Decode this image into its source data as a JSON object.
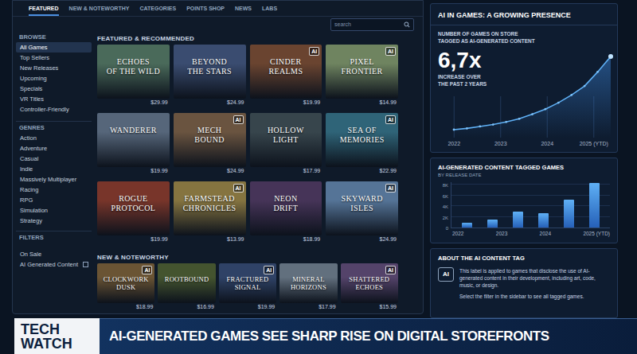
{
  "nav": {
    "tabs": [
      {
        "label": "FEATURED",
        "selected": true
      },
      {
        "label": "NEW & NOTEWORTHY",
        "selected": false
      },
      {
        "label": "CATEGORIES",
        "selected": false
      },
      {
        "label": "POINTS SHOP",
        "selected": false
      },
      {
        "label": "NEWS",
        "selected": false
      },
      {
        "label": "LABS",
        "selected": false
      }
    ]
  },
  "search": {
    "placeholder": "search"
  },
  "sidebar": {
    "sections": [
      {
        "heading": "BROWSE",
        "items": [
          {
            "label": "All Games",
            "selected": true
          },
          {
            "label": "Top Sellers",
            "selected": false
          },
          {
            "label": "New Releases",
            "selected": false
          },
          {
            "label": "Upcoming",
            "selected": false
          },
          {
            "label": "Specials",
            "selected": false
          },
          {
            "label": "VR Titles",
            "selected": false
          },
          {
            "label": "Controller-Friendly",
            "selected": false
          }
        ]
      },
      {
        "heading": "GENRES",
        "items": [
          {
            "label": "Action",
            "selected": false
          },
          {
            "label": "Adventure",
            "selected": false
          },
          {
            "label": "Casual",
            "selected": false
          },
          {
            "label": "Indie",
            "selected": false
          },
          {
            "label": "Massively Multiplayer",
            "selected": false
          },
          {
            "label": "Racing",
            "selected": false
          },
          {
            "label": "RPG",
            "selected": false
          },
          {
            "label": "Simulation",
            "selected": false
          },
          {
            "label": "Strategy",
            "selected": false
          }
        ]
      }
    ],
    "filters": {
      "heading": "FILTERS",
      "items": [
        {
          "label": "On Sale",
          "kind": "link"
        },
        {
          "label": "AI Generated Content",
          "kind": "checkbox",
          "checked": false
        }
      ]
    }
  },
  "ai_badge": "AI",
  "featured": {
    "heading": "FEATURED & RECOMMENDED",
    "games": [
      {
        "title_lines": [
          "ECHOES",
          "OF THE WILD"
        ],
        "price": "$29.99",
        "ai_tagged": false,
        "color": "#4a6a5a"
      },
      {
        "title_lines": [
          "BEYOND",
          "THE STARS"
        ],
        "price": "$24.99",
        "ai_tagged": false,
        "color": "#3a4c70"
      },
      {
        "title_lines": [
          "CINDER",
          "REALMS"
        ],
        "price": "$19.99",
        "ai_tagged": true,
        "color": "#6a4430"
      },
      {
        "title_lines": [
          "PIXEL",
          "FRONTIER"
        ],
        "price": "$14.99",
        "ai_tagged": true,
        "color": "#6f8460"
      },
      {
        "title_lines": [
          "WANDERER"
        ],
        "price": "$19.99",
        "ai_tagged": false,
        "color": "#56667a"
      },
      {
        "title_lines": [
          "MECH",
          "BOUND"
        ],
        "price": "$24.99",
        "ai_tagged": true,
        "color": "#6a5440"
      },
      {
        "title_lines": [
          "HOLLOW",
          "LIGHT"
        ],
        "price": "$17.99",
        "ai_tagged": false,
        "color": "#37454c"
      },
      {
        "title_lines": [
          "SEA OF",
          "MEMORIES"
        ],
        "price": "$22.99",
        "ai_tagged": true,
        "color": "#2f6478"
      },
      {
        "title_lines": [
          "ROGUE",
          "PROTOCOL"
        ],
        "price": "$19.99",
        "ai_tagged": false,
        "color": "#78352a"
      },
      {
        "title_lines": [
          "FARMSTEAD",
          "CHRONICLES"
        ],
        "price": "$13.99",
        "ai_tagged": true,
        "color": "#857440"
      },
      {
        "title_lines": [
          "NEON",
          "DRIFT"
        ],
        "price": "$18.99",
        "ai_tagged": false,
        "color": "#463458"
      },
      {
        "title_lines": [
          "SKYWARD",
          "ISLES"
        ],
        "price": "$24.99",
        "ai_tagged": true,
        "color": "#557497"
      }
    ]
  },
  "new": {
    "heading": "NEW & NOTEWORTHY",
    "games": [
      {
        "title_lines": [
          "CLOCKWORK",
          "DUSK"
        ],
        "price": "$18.99",
        "ai_tagged": true,
        "color": "#6a5434"
      },
      {
        "title_lines": [
          "ROOTBOUND"
        ],
        "price": "$16.99",
        "ai_tagged": false,
        "color": "#44542f"
      },
      {
        "title_lines": [
          "FRACTURED",
          "SIGNAL"
        ],
        "price": "$19.99",
        "ai_tagged": true,
        "color": "#2f4266"
      },
      {
        "title_lines": [
          "MINERAL",
          "HORIZONS"
        ],
        "price": "$17.99",
        "ai_tagged": false,
        "color": "#62707e"
      },
      {
        "title_lines": [
          "SHATTERED",
          "ECHOES"
        ],
        "price": "$15.99",
        "ai_tagged": true,
        "color": "#54436a"
      }
    ]
  },
  "growth_card": {
    "title": "AI IN GAMES: A GROWING PRESENCE",
    "subtitle_lines": [
      "NUMBER OF GAMES ON STORE",
      "TAGGED AS AI-GENERATED CONTENT"
    ],
    "figure": "6,7x",
    "caption_lines": [
      "INCREASE OVER",
      "THE PAST 2 YEARS"
    ],
    "x_labels": [
      "2022",
      "2023",
      "2024",
      "2025 (YTD)"
    ],
    "values": [
      1,
      1.1,
      1.25,
      1.4,
      1.6,
      1.85,
      2.2,
      2.6,
      3.1,
      3.7,
      4.4,
      5.5,
      6.7
    ]
  },
  "bar_card": {
    "title": "AI-GENERATED CONTENT TAGGED GAMES",
    "subtitle": "BY RELEASE DATE",
    "ticks": [
      {
        "label": "8K",
        "value": 8000
      },
      {
        "label": "6K",
        "value": 6000
      },
      {
        "label": "4K",
        "value": 4000
      },
      {
        "label": "2K",
        "value": 2000
      },
      {
        "label": "0",
        "value": 0
      }
    ],
    "values": [
      900,
      1500,
      2900,
      2700,
      5200,
      8300
    ],
    "x_labels": [
      "2022",
      "2023",
      "2024",
      "2025 (YTD)"
    ]
  },
  "about_card": {
    "title": "ABOUT THE AI CONTENT TAG",
    "icon_label": "AI",
    "paragraphs": [
      "This label is applied to games that disclose the use of AI-generated content in their development, including art, code, music, or design.",
      "Select the filter in the sidebar to see all tagged games."
    ]
  },
  "banner": {
    "tag_lines": [
      "TECH",
      "WATCH"
    ],
    "headline": "AI-GENERATED GAMES SEE SHARP RISE ON DIGITAL STOREFRONTS"
  }
}
